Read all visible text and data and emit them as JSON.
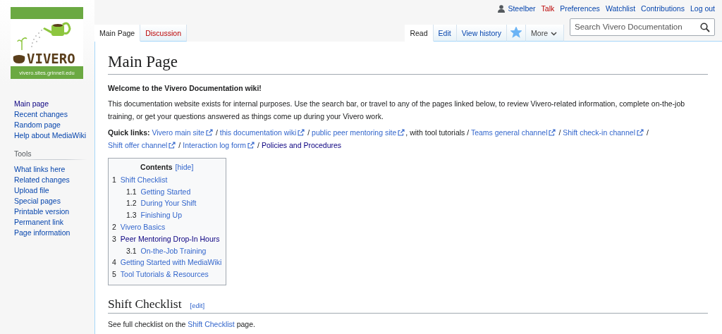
{
  "logo": {
    "wordmark": "VIVERO",
    "caption": "vivero.sites.grinnell.edu"
  },
  "personal_tools": [
    {
      "kind": "user",
      "label": "Steelber",
      "missing": false
    },
    {
      "kind": "link",
      "label": "Talk",
      "missing": true
    },
    {
      "kind": "link",
      "label": "Preferences",
      "missing": false
    },
    {
      "kind": "link",
      "label": "Watchlist",
      "missing": false
    },
    {
      "kind": "link",
      "label": "Contributions",
      "missing": false
    },
    {
      "kind": "link",
      "label": "Log out",
      "missing": false
    }
  ],
  "left_tabs": [
    {
      "label": "Main Page",
      "selected": true,
      "missing": false
    },
    {
      "label": "Discussion",
      "selected": false,
      "missing": true
    }
  ],
  "right_tabs": [
    {
      "kind": "tab",
      "label": "Read",
      "selected": true
    },
    {
      "kind": "tab",
      "label": "Edit",
      "selected": false
    },
    {
      "kind": "tab",
      "label": "View history",
      "selected": false
    },
    {
      "kind": "watch",
      "watched": true
    },
    {
      "kind": "menu",
      "label": "More"
    }
  ],
  "search": {
    "placeholder": "Search Vivero Documentation"
  },
  "sidebar": {
    "navigation": [
      {
        "label": "Main page",
        "visited": true
      },
      {
        "label": "Recent changes",
        "visited": false
      },
      {
        "label": "Random page",
        "visited": false
      },
      {
        "label": "Help about MediaWiki",
        "visited": false
      }
    ],
    "tools": {
      "heading": "Tools",
      "items": [
        {
          "label": "What links here",
          "visited": false
        },
        {
          "label": "Related changes",
          "visited": false
        },
        {
          "label": "Upload file",
          "visited": false
        },
        {
          "label": "Special pages",
          "visited": false
        },
        {
          "label": "Printable version",
          "visited": false
        },
        {
          "label": "Permanent link",
          "visited": false
        },
        {
          "label": "Page information",
          "visited": false
        }
      ]
    }
  },
  "page": {
    "title": "Main Page",
    "welcome": "Welcome to the Vivero Documentation wiki!",
    "intro": "This documentation website exists for internal purposes. Use the search bar, or travel to any of the pages linked below, to review Vivero-related information, complete on-the-job training, or get your questions answered as things come up during your Vivero work.",
    "quick_links": {
      "label": "Quick links:",
      "segments": [
        {
          "kind": "link",
          "text": "Vivero main site",
          "external": true,
          "visited": false
        },
        {
          "kind": "text",
          "text": " / "
        },
        {
          "kind": "link",
          "text": "this documentation wiki",
          "external": true,
          "visited": false
        },
        {
          "kind": "text",
          "text": " / "
        },
        {
          "kind": "link",
          "text": "public peer mentoring site",
          "external": true,
          "visited": false
        },
        {
          "kind": "text",
          "text": ", with tool tutorials / "
        },
        {
          "kind": "link",
          "text": "Teams general channel",
          "external": true,
          "visited": false
        },
        {
          "kind": "text",
          "text": " / "
        },
        {
          "kind": "link",
          "text": "Shift check-in channel",
          "external": true,
          "visited": false
        },
        {
          "kind": "text",
          "text": " / "
        },
        {
          "kind": "link",
          "text": "Shift offer channel",
          "external": true,
          "visited": false
        },
        {
          "kind": "text",
          "text": " / "
        },
        {
          "kind": "link",
          "text": "Interaction log form",
          "external": true,
          "visited": false
        },
        {
          "kind": "text",
          "text": " / "
        },
        {
          "kind": "link",
          "text": "Policies and Procedures",
          "external": false,
          "visited": true
        }
      ]
    },
    "toc": {
      "title": "Contents",
      "toggle": "[hide]",
      "items": [
        {
          "number": "1",
          "label": "Shift Checklist",
          "visited": false,
          "children": [
            {
              "number": "1.1",
              "label": "Getting Started",
              "visited": false
            },
            {
              "number": "1.2",
              "label": "During Your Shift",
              "visited": false
            },
            {
              "number": "1.3",
              "label": "Finishing Up",
              "visited": false
            }
          ]
        },
        {
          "number": "2",
          "label": "Vivero Basics",
          "visited": false
        },
        {
          "number": "3",
          "label": "Peer Mentoring Drop-In Hours",
          "visited": true,
          "children": [
            {
              "number": "3.1",
              "label": "On-the-Job Training",
              "visited": false
            }
          ]
        },
        {
          "number": "4",
          "label": "Getting Started with MediaWiki",
          "visited": false
        },
        {
          "number": "5",
          "label": "Tool Tutorials & Resources",
          "visited": false
        }
      ]
    },
    "sections": [
      {
        "heading": "Shift Checklist",
        "edit": "[edit]",
        "body": [
          {
            "kind": "text",
            "text": "See full checklist on the "
          },
          {
            "kind": "link",
            "text": "Shift Checklist",
            "external": false,
            "visited": false
          },
          {
            "kind": "text",
            "text": " page."
          }
        ]
      }
    ]
  }
}
